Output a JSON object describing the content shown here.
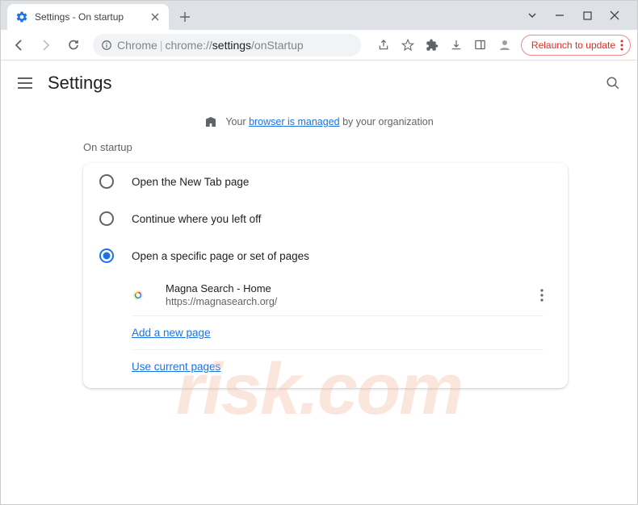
{
  "tab": {
    "title": "Settings - On startup"
  },
  "toolbar": {
    "scheme": "Chrome",
    "url_prefix": "chrome://",
    "url_bold": "settings",
    "url_suffix": "/onStartup",
    "relaunch_label": "Relaunch to update"
  },
  "header": {
    "title": "Settings"
  },
  "banner": {
    "prefix": "Your ",
    "link": "browser is managed",
    "suffix": " by your organization"
  },
  "section": {
    "label": "On startup"
  },
  "options": {
    "new_tab": "Open the New Tab page",
    "continue": "Continue where you left off",
    "specific": "Open a specific page or set of pages"
  },
  "pages": [
    {
      "title": "Magna Search - Home",
      "url": "https://magnasearch.org/"
    }
  ],
  "actions": {
    "add_page": "Add a new page",
    "use_current": "Use current pages"
  },
  "watermark": "risk.com"
}
